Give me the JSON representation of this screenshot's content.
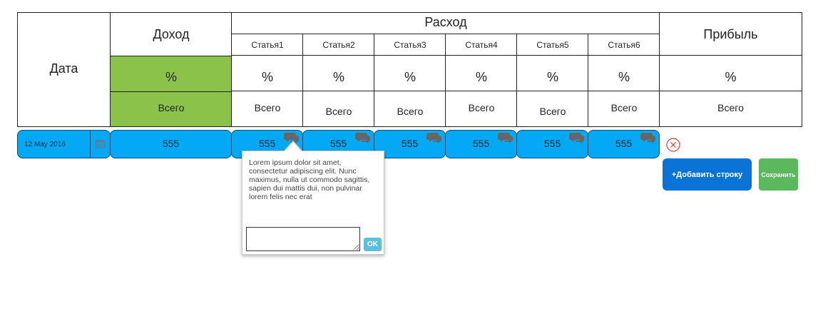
{
  "header": {
    "date": "Дата",
    "income": "Доход",
    "expense": "Расход",
    "profit": "Прибыль",
    "items": [
      "Статья1",
      "Статья2",
      "Статья3",
      "Статья4",
      "Статья5",
      "Статья6"
    ],
    "percent": "%",
    "total": "Всего"
  },
  "row": {
    "date": "12 May 2016",
    "income": "555",
    "expenses": [
      "555",
      "555",
      "555",
      "555",
      "555",
      "555"
    ]
  },
  "popup": {
    "text": "Lorem ipsum dolor sit amet, consectetur adipiscing elit. Nunc maximus, nulla ut commodo sagittis, sapien dui mattis dui, non pulvinar lorem felis nec erat",
    "textarea_value": "",
    "ok_label": "OK"
  },
  "actions": {
    "add_row": "+Добавить строку",
    "save": "Сохранить"
  },
  "colors": {
    "green": "#8bc34a",
    "blue": "#03a9f4",
    "add_button": "#0a73d8",
    "save_button": "#5cb85c",
    "delete": "#e53935"
  },
  "icons": {
    "calendar": "calendar-icon",
    "comment": "comment-icon",
    "delete": "close-circle-icon"
  }
}
